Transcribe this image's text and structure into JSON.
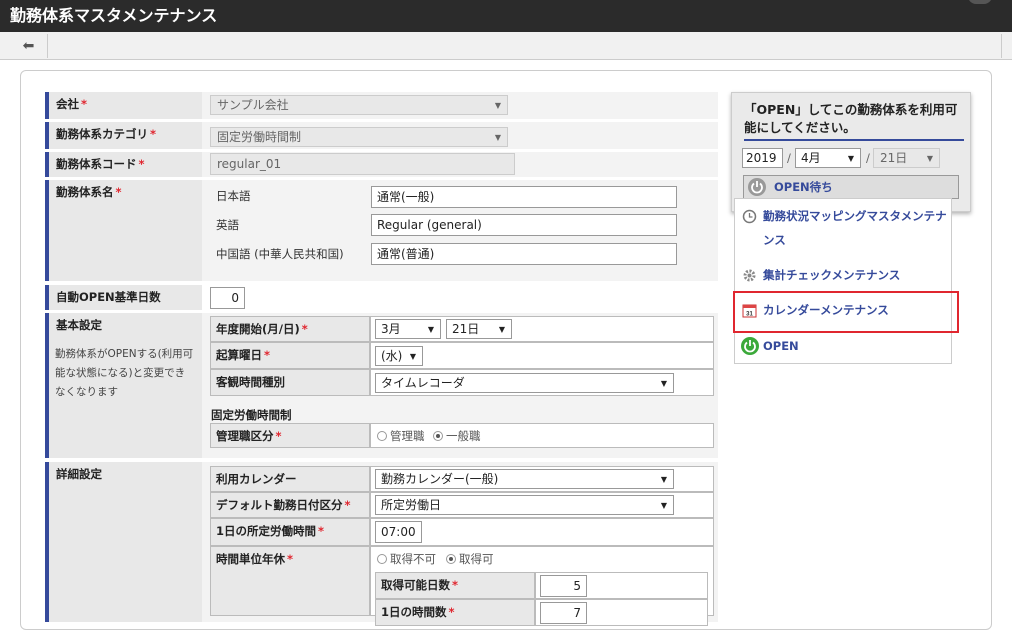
{
  "window": {
    "title": "勤務体系マスタメンテナンス"
  },
  "form": {
    "company": {
      "label": "会社",
      "value": "サンプル会社"
    },
    "category": {
      "label": "勤務体系カテゴリ",
      "value": "固定労働時間制"
    },
    "code": {
      "label": "勤務体系コード",
      "value": "regular_01"
    },
    "name": {
      "label": "勤務体系名",
      "ja_label": "日本語",
      "ja_value": "通常(一般)",
      "en_label": "英語",
      "en_value": "Regular (general)",
      "zh_label": "中国語 (中華人民共和国)",
      "zh_value": "通常(普通)"
    },
    "auto_open": {
      "label": "自動OPEN基準日数",
      "value": "0"
    },
    "basic": {
      "label": "基本設定",
      "desc": "勤務体系がOPENする(利用可能な状態になる)と変更できなくなります",
      "fiscal_label": "年度開始(月/日)",
      "fiscal_month": "3月",
      "fiscal_day": "21日",
      "calc_label": "起算曜日",
      "calc_value": "(水)",
      "obj_label": "客観時間種別",
      "obj_value": "タイムレコーダ",
      "fixed_heading": "固定労働時間制",
      "mgr_label": "管理職区分",
      "mgr_opt1": "管理職",
      "mgr_opt2": "一般職"
    },
    "detail": {
      "label": "詳細設定",
      "cal_label": "利用カレンダー",
      "cal_value": "勤務カレンダー(一般)",
      "default_label": "デフォルト勤務日付区分",
      "default_value": "所定労働日",
      "daily_label": "1日の所定労働時間",
      "daily_value": "07:00",
      "hourly_label": "時間単位年休",
      "hourly_opt1": "取得不可",
      "hourly_opt2": "取得可",
      "avail_label": "取得可能日数",
      "avail_value": "5",
      "partial_label": "1日の時間数",
      "partial_value": "7"
    }
  },
  "open_panel": {
    "message": "「OPEN」してこの勤務体系を利用可能にしてください。",
    "year": "2019",
    "month": "4月",
    "day": "21日",
    "button": "OPEN待ち"
  },
  "menu": {
    "items": [
      "勤務状況マッピングマスタメンテナンス",
      "集計チェックメンテナンス",
      "カレンダーメンテナンス",
      "OPEN"
    ]
  },
  "colors": {
    "accent": "#354a9b",
    "highlight": "#e0262f",
    "titlebar": "#2b2b2b"
  }
}
